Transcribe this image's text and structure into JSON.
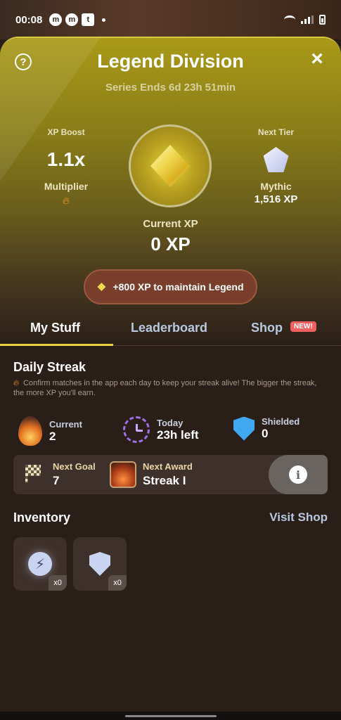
{
  "status_bar": {
    "time": "00:08"
  },
  "header": {
    "title": "Legend Division",
    "subtitle": "Series Ends 6d 23h 51min"
  },
  "xp_boost": {
    "label": "XP Boost",
    "value": "1.1x",
    "sublabel": "Multiplier"
  },
  "next_tier": {
    "label": "Next Tier",
    "name": "Mythic",
    "xp": "1,516 XP"
  },
  "current_xp": {
    "label": "Current XP",
    "value": "0 XP"
  },
  "maintain": {
    "text": "+800 XP to maintain Legend"
  },
  "tabs": [
    {
      "label": "My Stuff",
      "active": true
    },
    {
      "label": "Leaderboard",
      "active": false
    },
    {
      "label": "Shop",
      "active": false,
      "badge": "NEW!"
    }
  ],
  "daily_streak": {
    "title": "Daily Streak",
    "description": "Confirm matches in the app each day to keep your streak alive! The bigger the streak, the more XP you'll earn.",
    "stats": [
      {
        "label": "Current",
        "value": "2",
        "icon": "fire-icon"
      },
      {
        "label": "Today",
        "value": "23h left",
        "icon": "clock-icon"
      },
      {
        "label": "Shielded",
        "value": "0",
        "icon": "shield-icon"
      }
    ],
    "next_goal": {
      "label": "Next Goal",
      "value": "7"
    },
    "next_award": {
      "label": "Next Award",
      "value": "Streak I"
    }
  },
  "inventory": {
    "title": "Inventory",
    "link": "Visit Shop",
    "items": [
      {
        "icon": "xp-boost-icon",
        "count": "x0"
      },
      {
        "icon": "streak-shield-icon",
        "count": "x0"
      }
    ]
  },
  "colors": {
    "accent": "#e8d040",
    "background": "#2a1f18",
    "pill": "#7a3e2c",
    "link": "#b8c8e0",
    "badge": "#f06060"
  }
}
